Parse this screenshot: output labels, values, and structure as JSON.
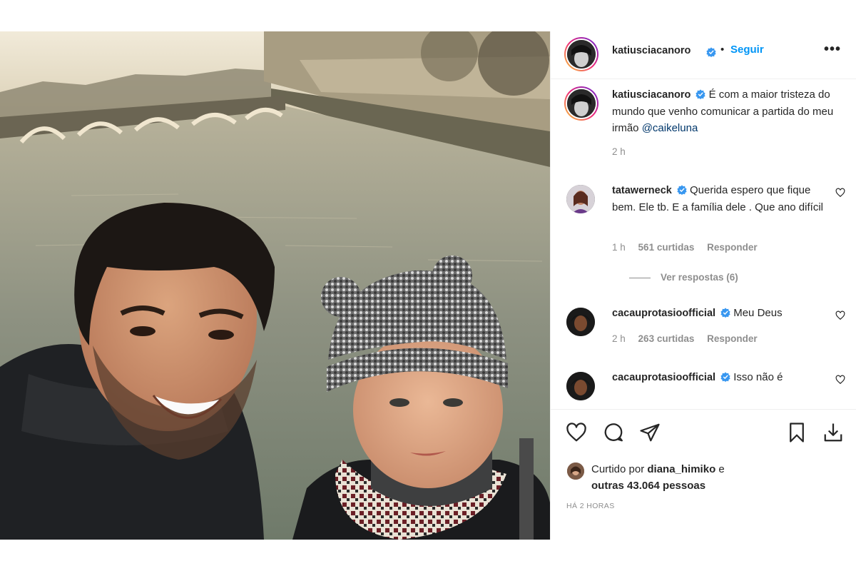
{
  "post": {
    "author": "katiusciacanoro",
    "follow_label": "Seguir",
    "separator": "•",
    "more_label": "•••"
  },
  "caption": {
    "username": "katiusciacanoro",
    "text": "É com a maior tristeza do mundo que venho comunicar a partida do meu irmão",
    "mention": "@caikeluna",
    "time": "2 h"
  },
  "comments": [
    {
      "username": "tatawerneck",
      "text": "Querida espero que fique bem. Ele tb. E a família dele . Que ano difícil",
      "time": "1 h",
      "likes": "561 curtidas",
      "reply": "Responder",
      "view_replies": "Ver respostas (6)"
    },
    {
      "username": "cacauprotasioofficial",
      "text": "Meu Deus",
      "time": "2 h",
      "likes": "263 curtidas",
      "reply": "Responder"
    },
    {
      "username": "cacauprotasioofficial",
      "text": "Isso não é"
    }
  ],
  "likes_summary": {
    "prefix": "Curtido por",
    "user": "diana_himiko",
    "connector": "e",
    "others": "outras 43.064 pessoas"
  },
  "timestamp": "HÁ 2 HORAS",
  "icons": [
    "heart-icon",
    "comment-icon",
    "share-icon",
    "bookmark-icon",
    "download-icon",
    "verified-icon",
    "more-icon"
  ],
  "colors": {
    "link": "#0095f6",
    "mention": "#00376b",
    "muted": "#8e8e8e",
    "border": "#efefef"
  }
}
